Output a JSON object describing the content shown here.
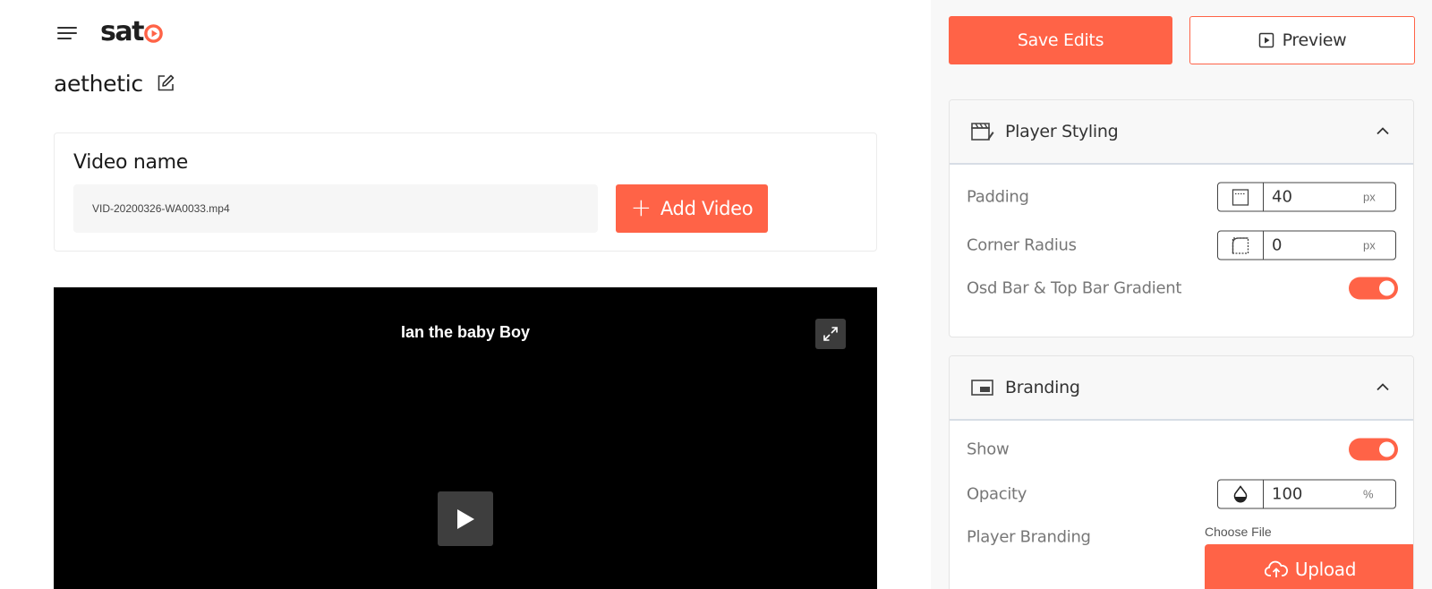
{
  "app": {
    "logo_text": "sat",
    "brand_color": "#ff6347"
  },
  "project": {
    "name": "aethetic"
  },
  "video_card": {
    "label": "Video name",
    "file_value": "VID-20200326-WA0033.mp4",
    "add_label": "Add Video"
  },
  "player": {
    "title": "Ian the baby Boy"
  },
  "toolbar": {
    "save_label": "Save Edits",
    "preview_label": "Preview"
  },
  "player_styling": {
    "title": "Player Styling",
    "padding": {
      "label": "Padding",
      "value": "40",
      "unit": "px"
    },
    "corner_radius": {
      "label": "Corner Radius",
      "value": "0",
      "unit": "px"
    },
    "gradient": {
      "label": "Osd Bar & Top Bar Gradient",
      "on": true
    }
  },
  "branding": {
    "title": "Branding",
    "show": {
      "label": "Show",
      "on": true
    },
    "opacity": {
      "label": "Opacity",
      "value": "100",
      "unit": "%"
    },
    "player_branding": {
      "label": "Player Branding",
      "choose_file": "Choose File",
      "upload_label": "Upload"
    }
  }
}
